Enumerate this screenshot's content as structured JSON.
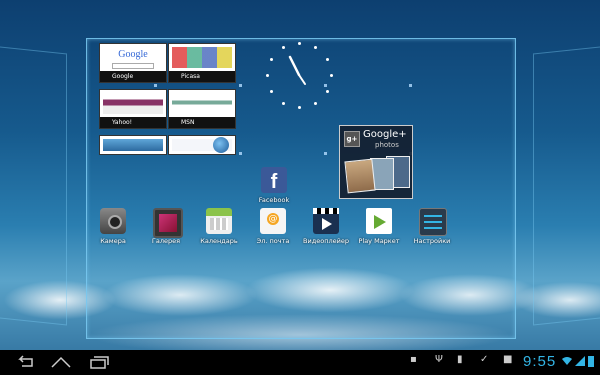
{
  "bookmarks": [
    {
      "label": "Google",
      "fav_color": "#4285f4"
    },
    {
      "label": "Picasa",
      "fav_color": "#e74c3c"
    },
    {
      "label": "Yahoo!",
      "fav_color": "#720e9e"
    },
    {
      "label": "MSN",
      "fav_color": "#00a1f1"
    },
    {
      "label": "",
      "fav_color": "#5fa7d9"
    },
    {
      "label": "",
      "fav_color": "#3a78c2"
    }
  ],
  "widget": {
    "title": "Google+",
    "subtitle": "photos",
    "badge": "g+"
  },
  "facebook": {
    "label": "Facebook",
    "glyph": "f"
  },
  "dock": [
    {
      "label": "Камера",
      "icon": "camera-icon"
    },
    {
      "label": "Галерея",
      "icon": "gallery-icon"
    },
    {
      "label": "Календарь",
      "icon": "calendar-icon"
    },
    {
      "label": "Эл. почта",
      "icon": "email-icon"
    },
    {
      "label": "Видеоплейер",
      "icon": "video-player-icon"
    },
    {
      "label": "Play Маркет",
      "icon": "play-market-icon"
    },
    {
      "label": "Настройки",
      "icon": "settings-icon"
    }
  ],
  "google_logo": "Google",
  "status": {
    "time": "9:55"
  },
  "colors": {
    "accent": "#33b5e5",
    "frame": "#78c8f0"
  }
}
